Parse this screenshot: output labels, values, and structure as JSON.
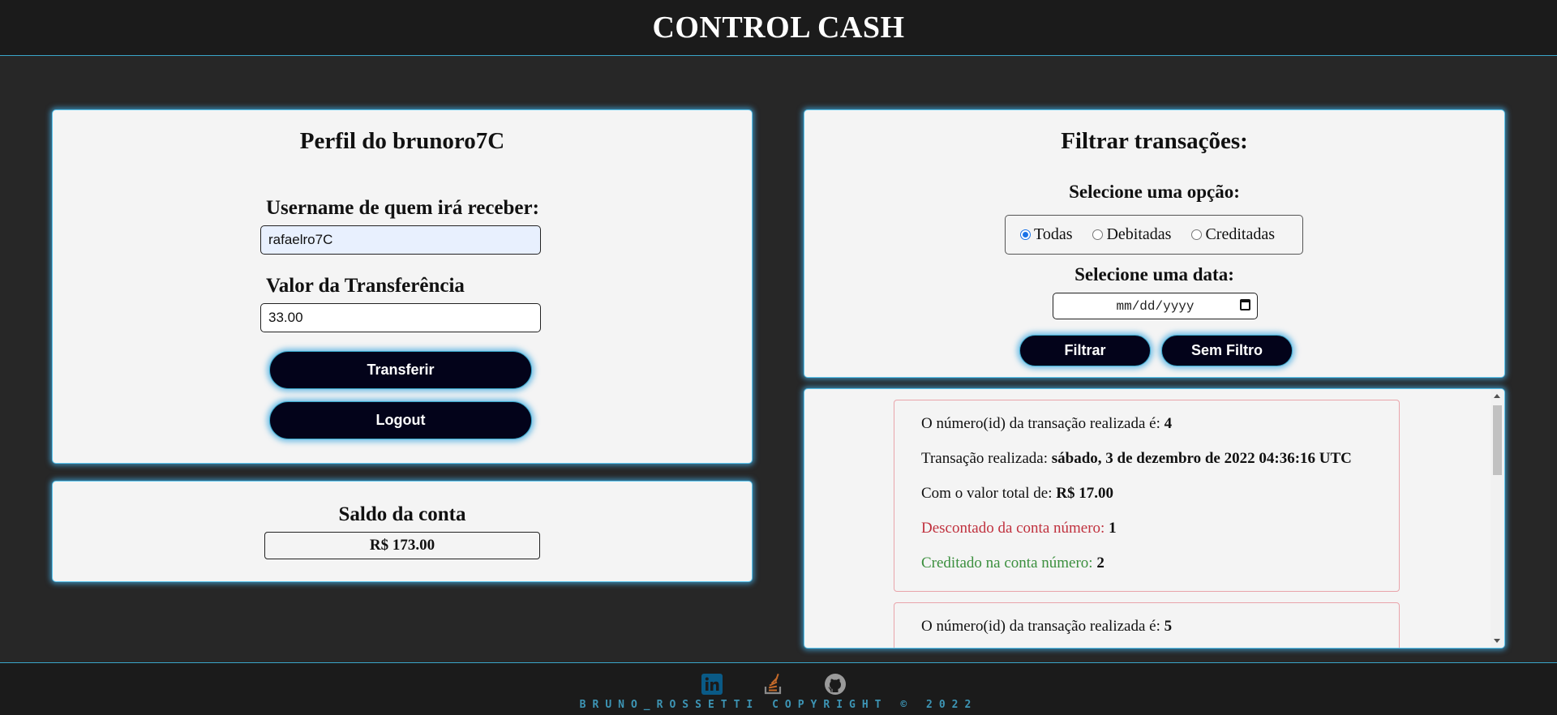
{
  "header": {
    "title": "CONTROL CASH"
  },
  "profile": {
    "title": "Perfil do brunoro7C",
    "recipient_label": "Username de quem irá receber:",
    "recipient_value": "rafaelro7C",
    "amount_label": "Valor da Transferência",
    "amount_value": "33.00",
    "transfer_button": "Transferir",
    "logout_button": "Logout"
  },
  "balance": {
    "title": "Saldo da conta",
    "value": "R$ 173.00"
  },
  "filter": {
    "title": "Filtrar transações:",
    "option_label": "Selecione uma opção:",
    "options": [
      {
        "label": "Todas",
        "checked": true
      },
      {
        "label": "Debitadas",
        "checked": false
      },
      {
        "label": "Creditadas",
        "checked": false
      }
    ],
    "date_label": "Selecione uma data:",
    "date_placeholder": "mm/dd/yyyy",
    "filter_button": "Filtrar",
    "no_filter_button": "Sem Filtro"
  },
  "transactions": {
    "id_text": "O número(id) da transação realizada é:",
    "date_text": "Transação realizada:",
    "value_text": "Com o valor total de:",
    "debited_text": "Descontado da conta número:",
    "credited_text": "Creditado na conta número:",
    "items": [
      {
        "id": "4",
        "date": "sábado, 3 de dezembro de 2022 04:36:16 UTC",
        "value": "R$ 17.00",
        "debited_account": "1",
        "credited_account": "2"
      },
      {
        "id": "5"
      }
    ]
  },
  "footer": {
    "icons": [
      "linkedin-icon",
      "stackoverflow-icon",
      "github-icon"
    ],
    "copyright": "BRUNO_ROSSETTI COPYRIGHT © 2022"
  },
  "colors": {
    "accent": "#3aa6c9",
    "button": "#03031a",
    "debit": "#c0313e",
    "credit": "#3b8f3e"
  }
}
